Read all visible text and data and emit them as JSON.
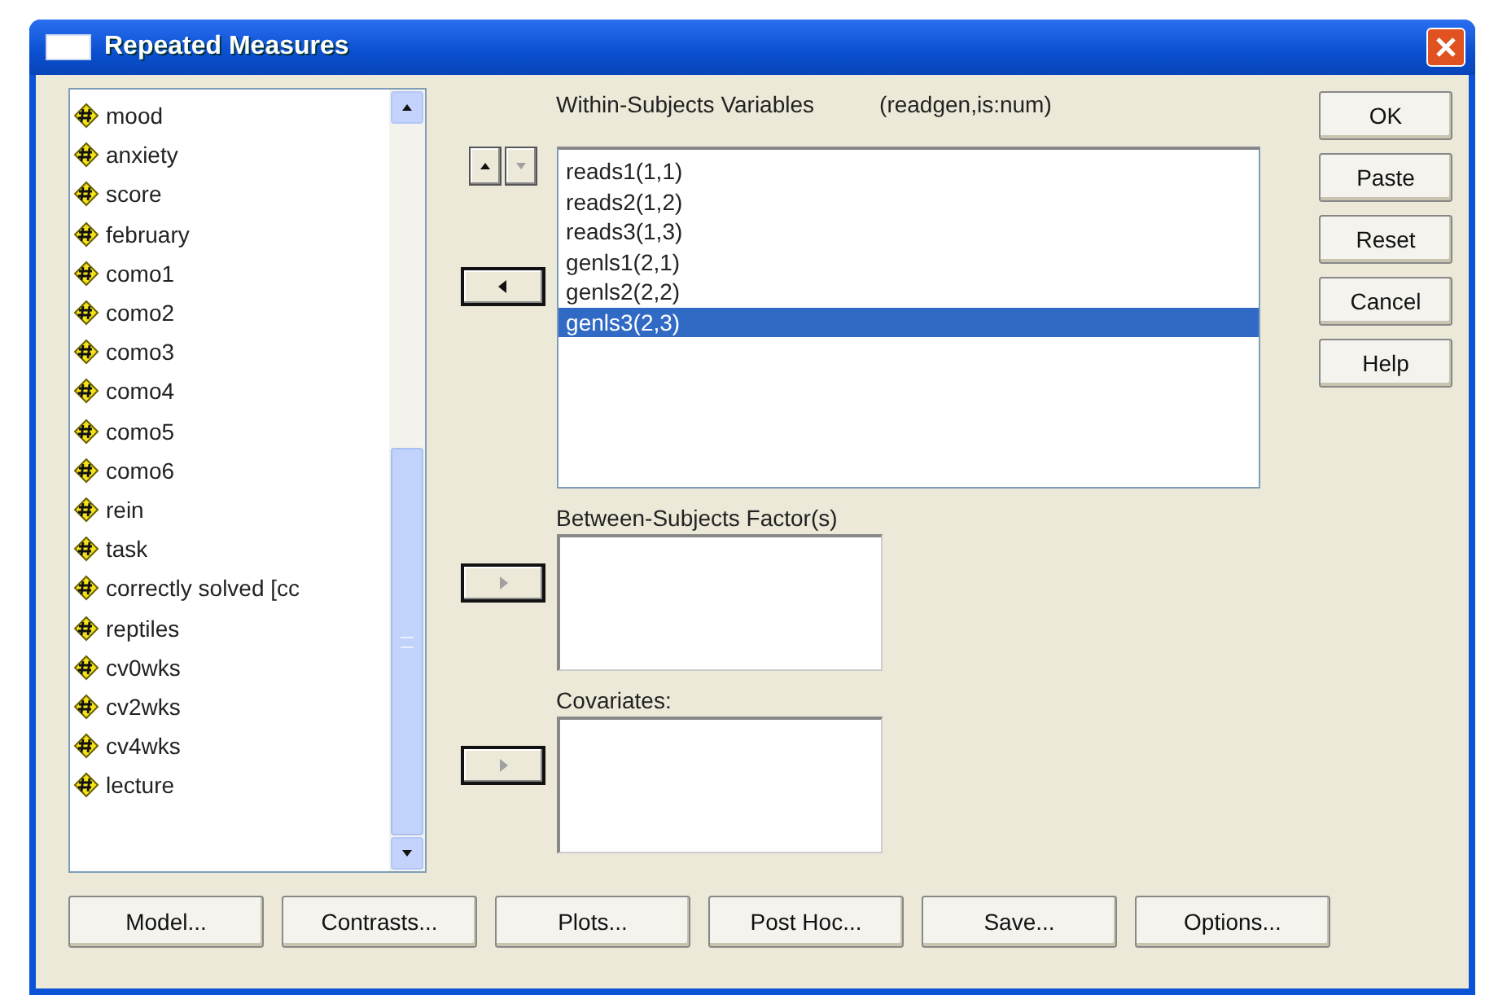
{
  "window": {
    "title": "Repeated Measures"
  },
  "source_variables": {
    "items": [
      {
        "label": "mood"
      },
      {
        "label": "anxiety"
      },
      {
        "label": "score"
      },
      {
        "label": "february"
      },
      {
        "label": "como1"
      },
      {
        "label": "como2"
      },
      {
        "label": "como3"
      },
      {
        "label": "como4"
      },
      {
        "label": "como5"
      },
      {
        "label": "como6"
      },
      {
        "label": "rein"
      },
      {
        "label": "task"
      },
      {
        "label": "correctly solved [cc"
      },
      {
        "label": "reptiles"
      },
      {
        "label": "cv0wks"
      },
      {
        "label": "cv2wks"
      },
      {
        "label": "cv4wks"
      },
      {
        "label": "lecture"
      }
    ]
  },
  "within_subjects": {
    "label": "Within-Subjects Variables",
    "factor": "(readgen,is:num)",
    "move_buttons": [
      {
        "kind": "up",
        "disabled": false
      },
      {
        "kind": "down",
        "disabled": true
      },
      {
        "kind": "left",
        "disabled": false
      }
    ],
    "items": [
      {
        "label": "reads1(1,1)",
        "selected": false
      },
      {
        "label": "reads2(1,2)",
        "selected": false
      },
      {
        "label": "reads3(1,3)",
        "selected": false
      },
      {
        "label": "genls1(2,1)",
        "selected": false
      },
      {
        "label": "genls2(2,2)",
        "selected": false
      },
      {
        "label": "genls3(2,3)",
        "selected": true
      }
    ]
  },
  "between_subjects": {
    "label": "Between-Subjects Factor(s)",
    "move_button": {
      "kind": "right",
      "disabled": true
    }
  },
  "covariates": {
    "label": "Covariates:",
    "move_button": {
      "kind": "right",
      "disabled": true
    }
  },
  "side_buttons": [
    "OK",
    "Paste",
    "Reset",
    "Cancel",
    "Help"
  ],
  "bottom_buttons": [
    "Model...",
    "Contrasts...",
    "Plots...",
    "Post Hoc...",
    "Save...",
    "Options..."
  ]
}
